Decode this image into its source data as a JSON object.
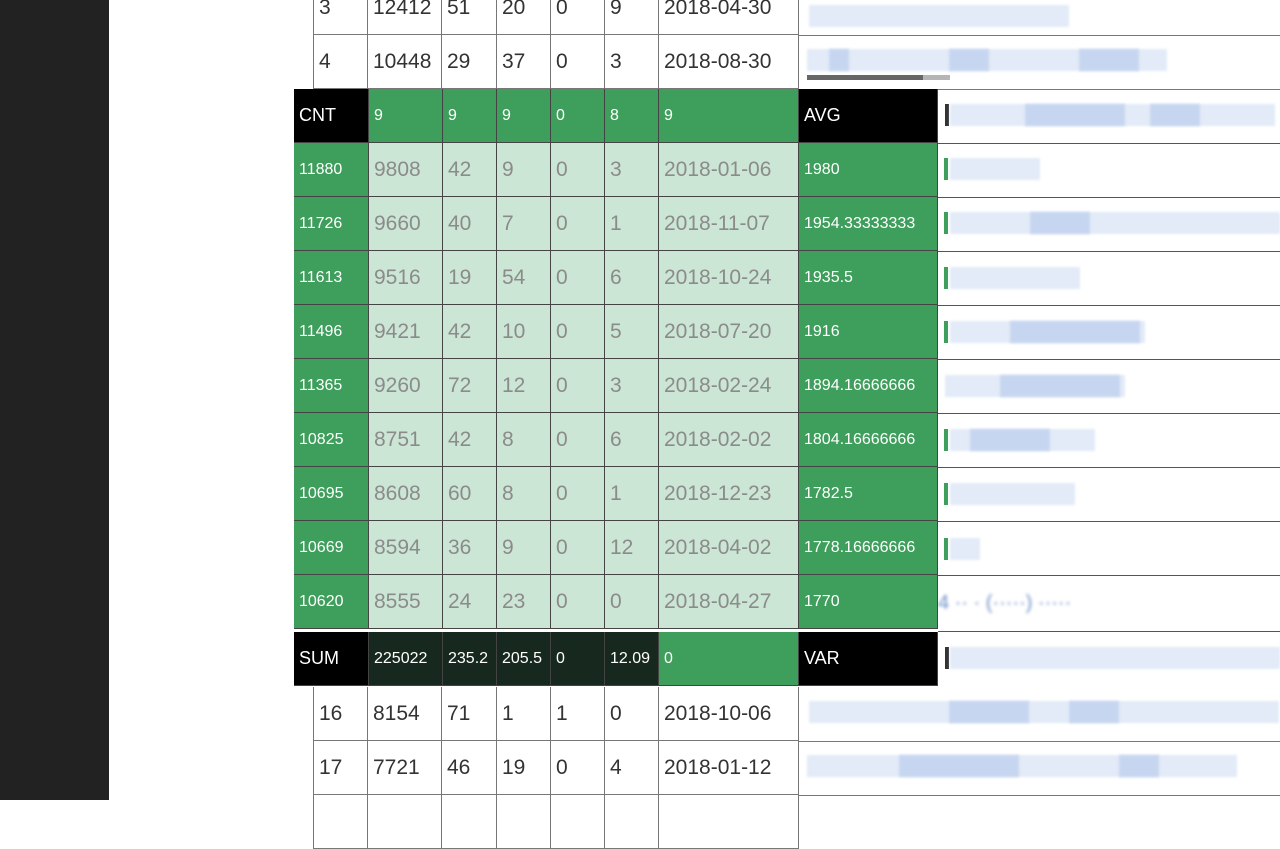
{
  "top_rows": [
    {
      "id": "3",
      "a": "12412",
      "b": "51",
      "c": "20",
      "d": "0",
      "e": "9",
      "date": "2018-04-30"
    },
    {
      "id": "4",
      "a": "10448",
      "b": "29",
      "c": "37",
      "d": "0",
      "e": "3",
      "date": "2018-08-30"
    }
  ],
  "overlay": {
    "header": {
      "label": "CNT",
      "a": "9",
      "b": "9",
      "c": "9",
      "d": "0",
      "e": "8",
      "date": "9",
      "stat_label": "AVG"
    },
    "rows": [
      {
        "key": "11880",
        "a": "9808",
        "b": "42",
        "c": "9",
        "d": "0",
        "e": "3",
        "date": "2018-01-06",
        "avg": "1980"
      },
      {
        "key": "11726",
        "a": "9660",
        "b": "40",
        "c": "7",
        "d": "0",
        "e": "1",
        "date": "2018-11-07",
        "avg": "1954.33333333"
      },
      {
        "key": "11613",
        "a": "9516",
        "b": "19",
        "c": "54",
        "d": "0",
        "e": "6",
        "date": "2018-10-24",
        "avg": "1935.5"
      },
      {
        "key": "11496",
        "a": "9421",
        "b": "42",
        "c": "10",
        "d": "0",
        "e": "5",
        "date": "2018-07-20",
        "avg": "1916"
      },
      {
        "key": "11365",
        "a": "9260",
        "b": "72",
        "c": "12",
        "d": "0",
        "e": "3",
        "date": "2018-02-24",
        "avg": "1894.16666666"
      },
      {
        "key": "10825",
        "a": "8751",
        "b": "42",
        "c": "8",
        "d": "0",
        "e": "6",
        "date": "2018-02-02",
        "avg": "1804.16666666"
      },
      {
        "key": "10695",
        "a": "8608",
        "b": "60",
        "c": "8",
        "d": "0",
        "e": "1",
        "date": "2018-12-23",
        "avg": "1782.5"
      },
      {
        "key": "10669",
        "a": "8594",
        "b": "36",
        "c": "9",
        "d": "0",
        "e": "12",
        "date": "2018-04-02",
        "avg": "1778.16666666"
      },
      {
        "key": "10620",
        "a": "8555",
        "b": "24",
        "c": "23",
        "d": "0",
        "e": "0",
        "date": "2018-04-27",
        "avg": "1770"
      }
    ],
    "footer": {
      "label": "SUM",
      "a": "225022",
      "b": "235.2",
      "c": "205.5",
      "d": "0",
      "e": "12.09",
      "date": "0",
      "stat_label": "VAR"
    }
  },
  "bottom_rows": [
    {
      "id": "16",
      "a": "8154",
      "b": "71",
      "c": "1",
      "d": "1",
      "e": "0",
      "date": "2018-10-06"
    },
    {
      "id": "17",
      "a": "7721",
      "b": "46",
      "c": "19",
      "d": "0",
      "e": "4",
      "date": "2018-01-12"
    }
  ],
  "colors": {
    "header_black": "#000000",
    "green": "#3e9e5b",
    "light_green": "#cbe6d4",
    "dark_green": "#17291e",
    "sidebar": "#222222"
  }
}
